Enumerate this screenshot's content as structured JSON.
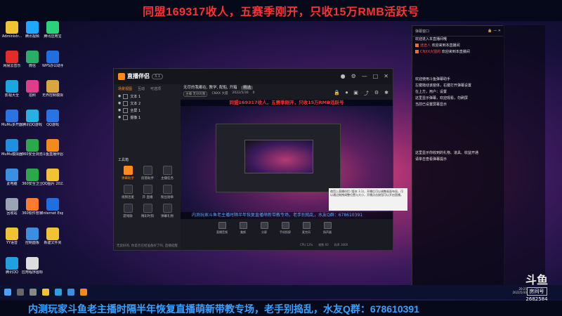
{
  "top_banner": "同盟169317收人，五赛季刚开，只收15万RMB活跃号",
  "bottom_marquee": "内测玩家斗鱼老主播时隔半年恢复直播萌新带教专场，老手别捣乱，水友Q群：678610391",
  "brand": {
    "name": "斗鱼",
    "tag": "房间号",
    "room": "2682584"
  },
  "desktop_icons": [
    {
      "label": "Administr...",
      "color": "#f1c232"
    },
    {
      "label": "腾讯视频",
      "color": "#1fa8ff"
    },
    {
      "label": "腾讯应用宝",
      "color": "#2ad37a"
    },
    {
      "label": "网易云音乐",
      "color": "#e22b2b"
    },
    {
      "label": "微信",
      "color": "#2aae67"
    },
    {
      "label": "WPS办公助手",
      "color": "#1f6fe0"
    },
    {
      "label": "影视大全",
      "color": "#1aa7e0"
    },
    {
      "label": "拍照",
      "color": "#e23b8a"
    },
    {
      "label": "无界控制模拟器",
      "color": "#d8a640"
    },
    {
      "label": "MuMu多开器",
      "color": "#2a73e0"
    },
    {
      "label": "腾讯QQ游戏",
      "color": "#2ab0e0"
    },
    {
      "label": "QQ游戏",
      "color": "#2a73e0"
    },
    {
      "label": "MuMu模拟器",
      "color": "#1f8fe0"
    },
    {
      "label": "360安全浏览器",
      "color": "#2aa84a"
    },
    {
      "label": "斗鱼直播伴侣",
      "color": "#f28a1c"
    },
    {
      "label": "此电脑",
      "color": "#3a8fe0"
    },
    {
      "label": "360安全卫士",
      "color": "#2aa84a"
    },
    {
      "label": "QQ图片 20220527...",
      "color": "#f1c232"
    },
    {
      "label": "回收站",
      "color": "#9aa4b2"
    },
    {
      "label": "360软件管家",
      "color": "#ff7a2a"
    },
    {
      "label": "Internet Explorer",
      "color": "#1f6fe0"
    },
    {
      "label": "YY语音",
      "color": "#f1c232"
    },
    {
      "label": "控制面板",
      "color": "#3a8fe0"
    },
    {
      "label": "新建文件夹",
      "color": "#f1c232"
    },
    {
      "label": "腾讯QQ",
      "color": "#1fa0e0"
    },
    {
      "label": "应用程序图标 - 只要是...",
      "color": "#ddd"
    }
  ],
  "obs": {
    "app_title": "直播伴侣",
    "version_badge": "3.1",
    "left_tabs": [
      "场景视图",
      "互动",
      "可选项"
    ],
    "scenes": [
      "文本 1",
      "文本 2",
      "全屏 1",
      "摄像 1"
    ],
    "tools_title": "工具箱",
    "tools": [
      "弹幕助手",
      "房管助手",
      "主播任务",
      "视频连麦",
      "开·直播",
      "粉丝勋章",
      "游戏联",
      "精彩时刻",
      "弹幕礼物"
    ],
    "left_status": "无良好的, 你是否已经准备好了吗, 直播提醒",
    "stream_title": "无尽的我都在, 教学, 配船, 开箱",
    "category_badge": "精选",
    "meta": [
      "主播 无尽的我",
      "CNXX 大盟",
      "2022/5/30",
      "0"
    ],
    "preview_banner": "同盟169317收人，五赛季刚开，只收15万RMB活跃号",
    "preview_marquee": "内测玩家斗鱼老主播时隔半年恢复直播萌新带教专场，老手别捣乱，水友Q群：678610391",
    "bottom_tools": [
      "直播音频",
      "美颜",
      "分屏",
      "手机投屏",
      "麦克风",
      "扬声器"
    ],
    "status_items": [
      "CPU 12%",
      "帧数 60",
      "码率 3000"
    ],
    "tooltip": "使用上直播伴侣 (版本 3.1)，开播后可以调整画面布局，可以通过拖拽调整位置与大小，开播点击按钮可以开启直播。"
  },
  "chat": {
    "header": "弹幕窗口",
    "online_label": "在线",
    "messages": [
      {
        "user": "",
        "text": "欢迎进入本直播间哦"
      },
      {
        "user": "迷途人",
        "text": "欢迎来到本直播间"
      },
      {
        "user": "CNXX大盟的",
        "text": "欢迎来到本直播间"
      },
      {
        "user": "",
        "text": "欢迎使用斗鱼弹幕助手"
      },
      {
        "user": "",
        "text": "左键拖动该窗体，右键打开弹幕设置"
      },
      {
        "user": "",
        "text": "在上方，用户：设置"
      },
      {
        "user": "",
        "text": "这里显示弹幕，欢迎观看，勿刷屏"
      },
      {
        "user": "",
        "text": "当前已设置屏幕显示"
      },
      {
        "user": "",
        "text": "这里显示你收到的礼物、道具、收益开通"
      },
      {
        "user": "",
        "text": "请单击查看弹幕提示"
      }
    ]
  },
  "taskbar": {
    "time": "20:25",
    "date": "2022/5/30"
  }
}
